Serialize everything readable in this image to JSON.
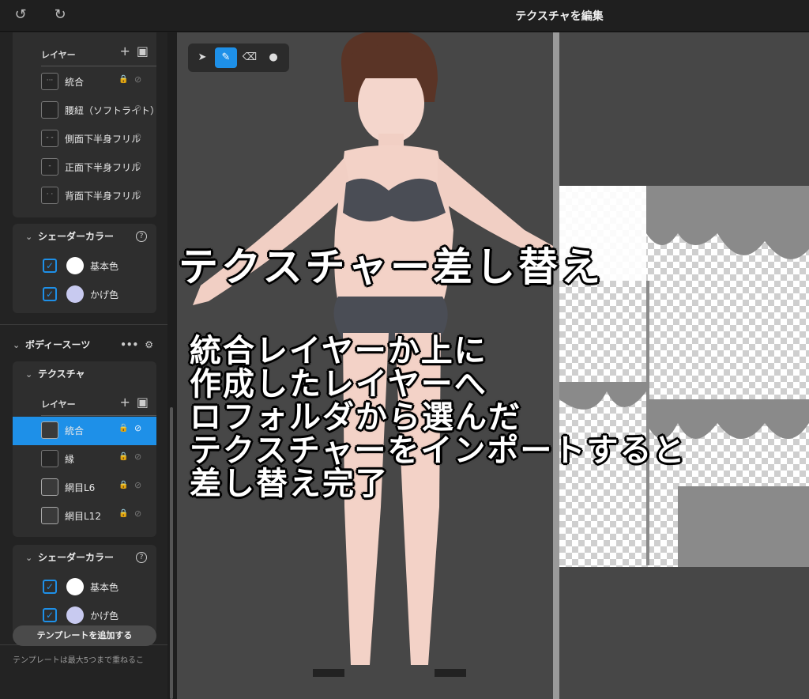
{
  "header": {
    "title": "テクスチャを編集",
    "undo_icon": "undo-icon",
    "redo_icon": "redo-icon"
  },
  "sidebar": {
    "upper_layers": {
      "label": "レイヤー",
      "items": [
        {
          "name": "統合",
          "thumb": "···"
        },
        {
          "name": "腰紐（ソフトライト）",
          "thumb": ""
        },
        {
          "name": "側面下半身フリル",
          "thumb": "- -"
        },
        {
          "name": "正面下半身フリル",
          "thumb": "-"
        },
        {
          "name": "背面下半身フリル",
          "thumb": "· ·"
        }
      ]
    },
    "shader1": {
      "title": "シェーダーカラー",
      "items": [
        {
          "label": "基本色",
          "color": "#ffffff"
        },
        {
          "label": "かげ色",
          "color": "#c8caf0"
        }
      ]
    },
    "bodysuit": {
      "title": "ボディースーツ",
      "more": "•••",
      "settings": "⚙"
    },
    "texture": {
      "title": "テクスチャ",
      "layer_label": "レイヤー",
      "items": [
        {
          "name": "統合",
          "selected": true
        },
        {
          "name": "縁",
          "selected": false
        },
        {
          "name": "網目L6",
          "selected": false
        },
        {
          "name": "網目L12",
          "selected": false
        }
      ]
    },
    "shader2": {
      "title": "シェーダーカラー",
      "items": [
        {
          "label": "基本色",
          "color": "#ffffff"
        },
        {
          "label": "かげ色",
          "color": "#c8caf0"
        }
      ]
    },
    "template_button": "テンプレートを追加する",
    "template_note": "テンプレートは最大5つまで重ねるこ"
  },
  "tools": [
    "select-tool",
    "pen-tool",
    "eraser-tool",
    "fill-tool"
  ],
  "overlay": {
    "headline": "テクスチャー差し替え",
    "lines": [
      "統合レイヤーか上に",
      "作成したレイヤーへ",
      "ロフォルダから選んだ",
      "テクスチャーをインポートすると",
      "差し替え完了"
    ]
  },
  "colors": {
    "accent": "#1e90e8",
    "panel": "#232323",
    "card": "#2e2e2e",
    "viewport": "#474747"
  }
}
